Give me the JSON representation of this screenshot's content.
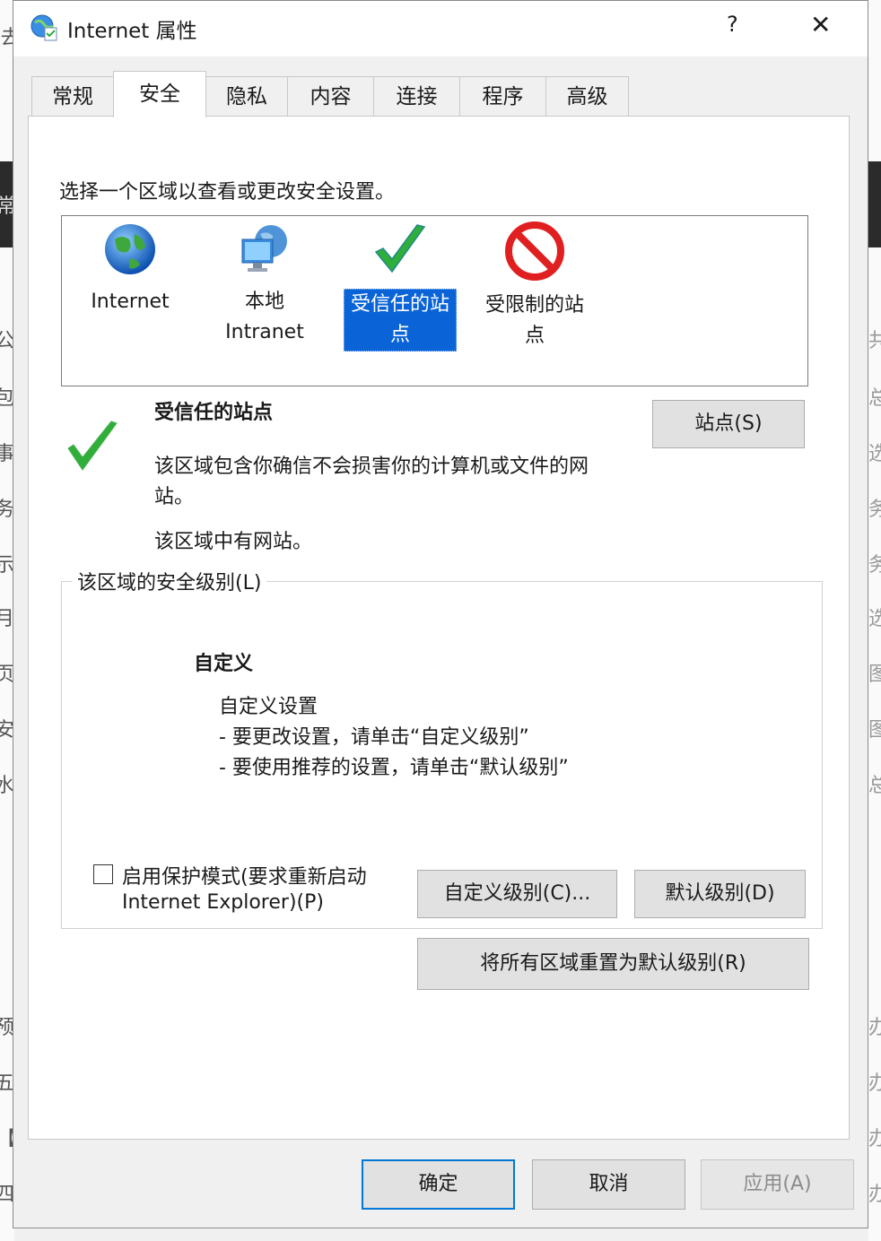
{
  "window": {
    "title": "Internet 属性",
    "help": "?",
    "close": "✕"
  },
  "tabs": [
    {
      "label": "常规"
    },
    {
      "label": "安全"
    },
    {
      "label": "隐私"
    },
    {
      "label": "内容"
    },
    {
      "label": "连接"
    },
    {
      "label": "程序"
    },
    {
      "label": "高级"
    }
  ],
  "security": {
    "prompt": "选择一个区域以查看或更改安全设置。",
    "zones": [
      {
        "line1": "Internet",
        "line2": "",
        "icon": "globe-icon"
      },
      {
        "line1": "本地",
        "line2": "Intranet",
        "icon": "network-monitor-icon"
      },
      {
        "line1": "受信任的站",
        "line2": "点",
        "icon": "checkmark-icon",
        "selected": true
      },
      {
        "line1": "受限制的站",
        "line2": "点",
        "icon": "restricted-icon"
      }
    ],
    "zone_title": "受信任的站点",
    "zone_desc_1": "该区域包含你确信不会损害你的计算机或文件的网",
    "zone_desc_2": "站。",
    "zone_status": "该区域中有网站。",
    "sites_button": "站点(S)",
    "level_group_label": "该区域的安全级别(L)",
    "level_name": "自定义",
    "level_line1": "自定义设置",
    "level_line2": "- 要更改设置，请单击“自定义级别”",
    "level_line3": "- 要使用推荐的设置，请单击“默认级别”",
    "protected_mode_1": "启用保护模式(要求重新启动",
    "protected_mode_2": "Internet Explorer)(P)",
    "protected_mode_checked": false,
    "custom_level_button": "自定义级别(C)...",
    "default_level_button": "默认级别(D)",
    "reset_all_button": "将所有区域重置为默认级别(R)"
  },
  "footer": {
    "ok": "确定",
    "cancel": "取消",
    "apply": "应用(A)"
  },
  "colors": {
    "selection": "#0a64d8",
    "primary_border": "#0078d7",
    "check_green": "#2fae3a",
    "stop_red": "#e02020"
  },
  "background": {
    "left_chars": [
      "(去",
      "常",
      "公",
      "包",
      "事",
      "务",
      "示",
      "月",
      "页",
      "安",
      "水",
      "预",
      "五",
      "【",
      "四"
    ],
    "right_chars": [
      "共",
      "总",
      "选",
      "务",
      "务",
      "选",
      "图",
      "图",
      "总",
      "办",
      "办",
      "办",
      "办"
    ]
  }
}
